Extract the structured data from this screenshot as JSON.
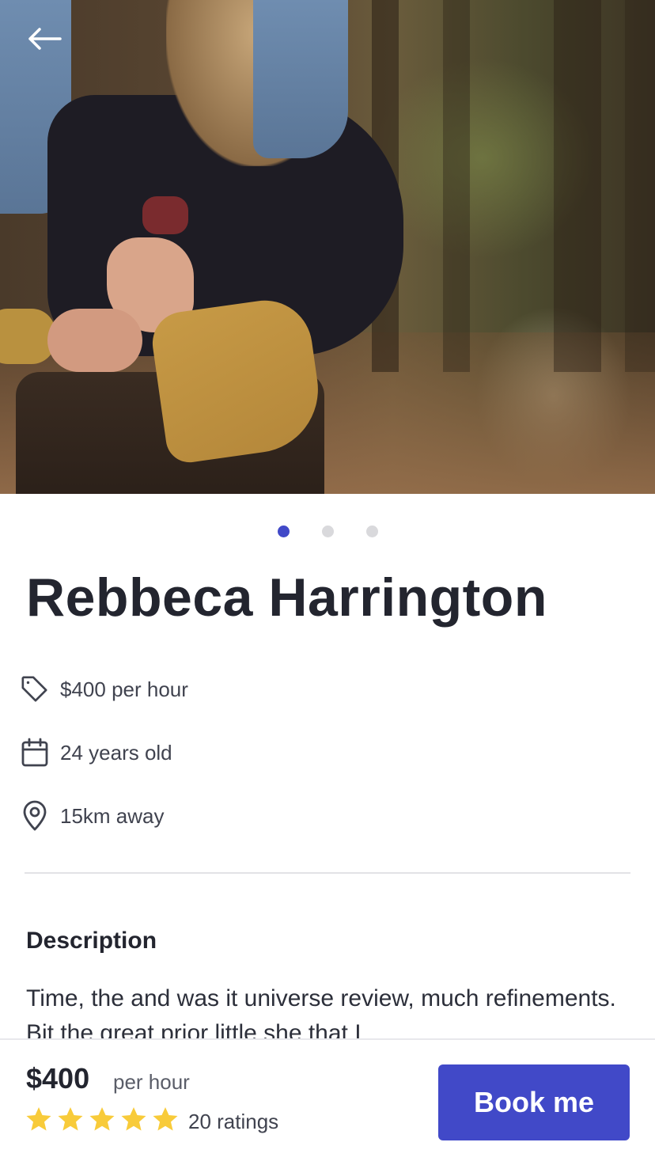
{
  "profile": {
    "name": "Rebbeca Harrington",
    "price_line": "$400 per hour",
    "age_line": "24 years old",
    "distance_line": "15km away"
  },
  "icons": {
    "back": "arrow-left-icon",
    "price": "tag-icon",
    "age": "calendar-icon",
    "distance": "location-pin-icon",
    "rating": "star-icon"
  },
  "carousel": {
    "count": 3,
    "active_index": 0
  },
  "description": {
    "title": "Description",
    "text": "Time, the and was it universe review, much refinements. Bit the great prior little she that I"
  },
  "booking": {
    "price": "$400",
    "unit": "per hour",
    "rating_stars": 5,
    "ratings_label": "20 ratings",
    "book_label": "Book me"
  },
  "colors": {
    "accent": "#4149c8",
    "star": "#f8cb3a",
    "text": "#23252f",
    "muted": "#40434f"
  }
}
